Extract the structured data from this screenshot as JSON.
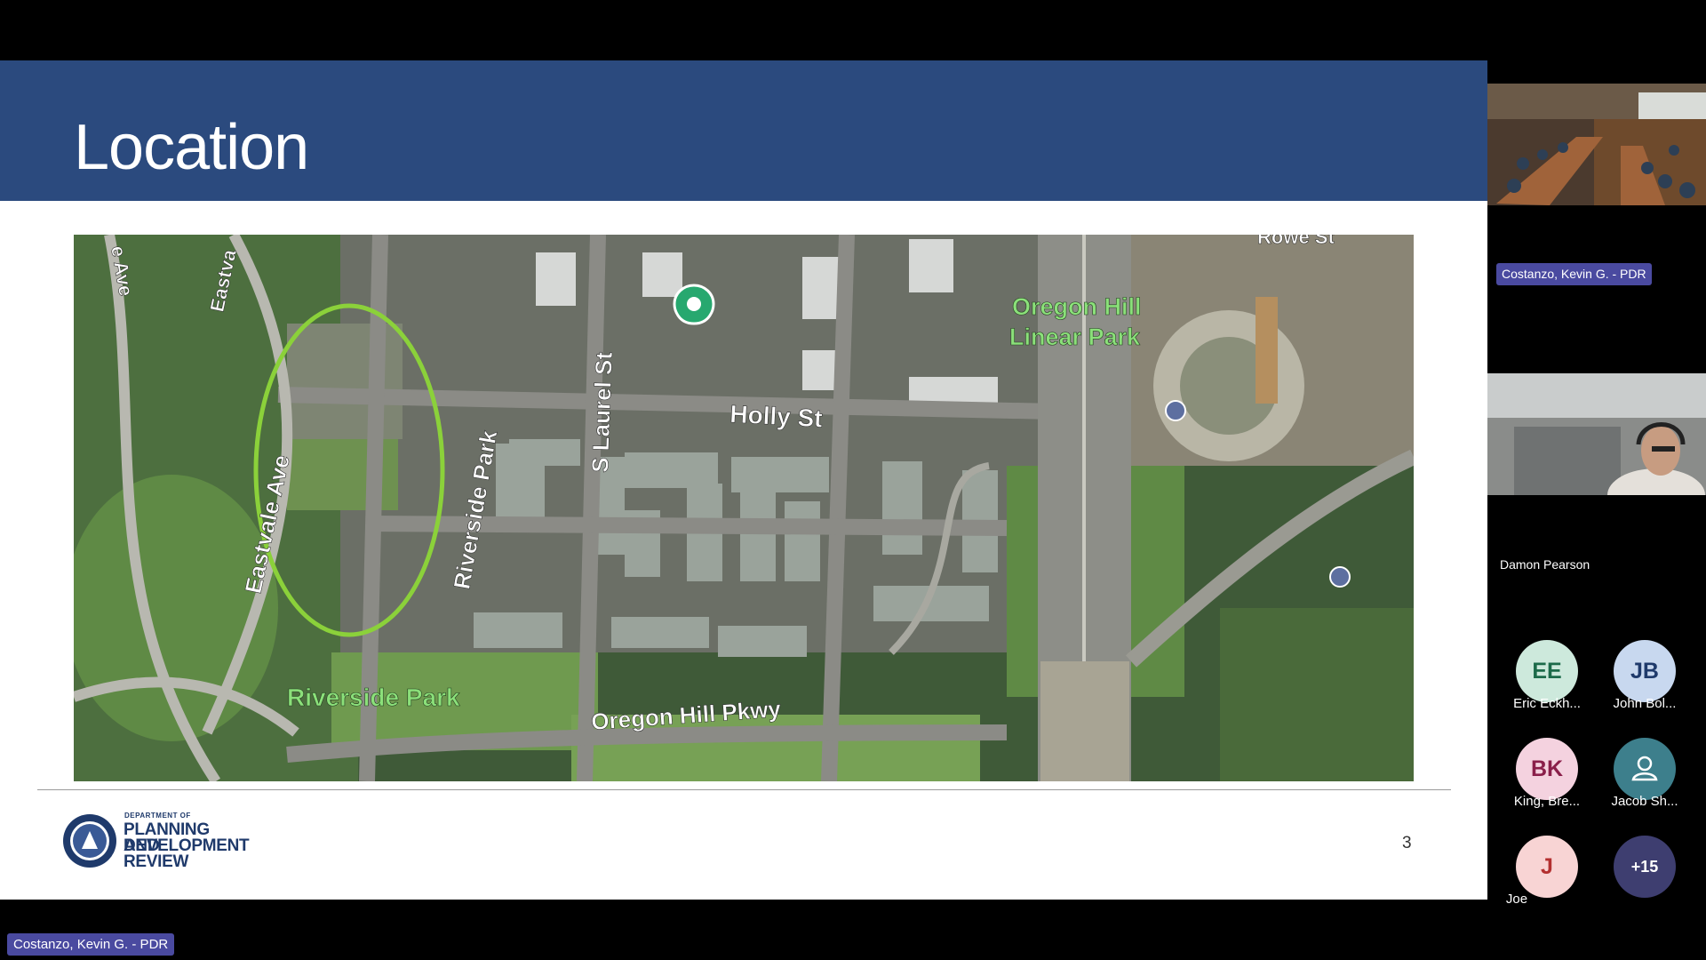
{
  "slide": {
    "title": "Location",
    "number": "3",
    "logo": {
      "department": "DEPARTMENT OF",
      "line1": "PLANNING AND",
      "line2": "DEVELOPMENT",
      "line3": "REVIEW"
    },
    "map": {
      "labels": {
        "eastvale_ave": "Eastvale Ave",
        "eastva_top": "Eastva",
        "e_ave_top": "e Ave",
        "riverside_park_street": "Riverside Park",
        "s_laurel": "S Laurel St",
        "holly": "Holly St",
        "oregon_hill_linear_park": [
          "Oregon Hill",
          "Linear Park"
        ],
        "riverside_park": "Riverside Park",
        "oregon_hill_pkwy": "Oregon Hill Pkwy",
        "rowe_top": "Rowe St"
      }
    }
  },
  "presenter_tag": "Costanzo, Kevin G. - PDR",
  "participants_panel": {
    "tiles": [
      {
        "name": "Costanzo, Kevin G. - PDR",
        "highlighted": true
      },
      {
        "name": "Damon Pearson",
        "highlighted": false
      }
    ],
    "avatars": [
      {
        "initials": "EE",
        "name": "Eric Eckh...",
        "bg": "#cde9dc",
        "fg": "#1c6b4a"
      },
      {
        "initials": "JB",
        "name": "John Bol...",
        "bg": "#c8d8ef",
        "fg": "#1f3a6b"
      },
      {
        "initials": "BK",
        "name": "King, Bre...",
        "bg": "#f4d2df",
        "fg": "#8a1f4a"
      },
      {
        "initials": "",
        "name": "Jacob Sh...",
        "bg": "#3d7f8c",
        "fg": "#ffffff",
        "icon": "person-icon"
      },
      {
        "initials": "J",
        "name": "Joe",
        "bg": "#f8d4d4",
        "fg": "#b33030"
      },
      {
        "initials": "+15",
        "name": "",
        "bg": "#3e3e70",
        "fg": "#ffffff"
      }
    ]
  }
}
